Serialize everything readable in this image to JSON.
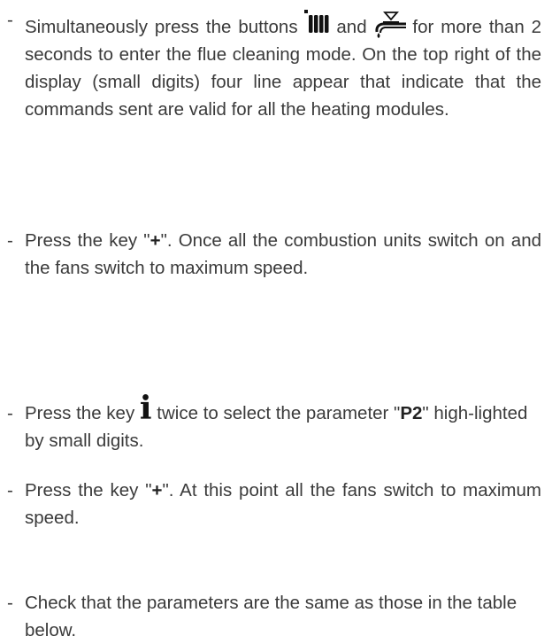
{
  "instructions": [
    {
      "bullet": "-",
      "parts": {
        "t1": "Simultaneously press the buttons",
        "icon1": "radiator-icon",
        "t2": "and",
        "icon2": "tap-water-icon",
        "t3": "for more than 2 seconds to enter the flue cleaning mode. On the top right of the display (small digits) four line appear that indicate that the commands sent are valid for all the heating modules."
      }
    },
    {
      "bullet": "-",
      "parts": {
        "t1": "Press the key \"",
        "key": "+",
        "t2": "\". Once all the combustion units switch on and the fans switch to maximum speed."
      }
    },
    {
      "bullet": "-",
      "parts": {
        "t1": "Press the key",
        "icon": "info-icon",
        "icon_glyph": "i",
        "t2": "twice to select the parameter \"",
        "param": "P2",
        "t3": "\" high-lighted by small digits."
      }
    },
    {
      "bullet": "-",
      "parts": {
        "t1": "Press the key \"",
        "key": "+",
        "t2": "\". At this point all the fans switch to maximum speed."
      }
    },
    {
      "bullet": "-",
      "parts": {
        "t1": "Check that the parameters are the same as those in the table below."
      }
    }
  ]
}
